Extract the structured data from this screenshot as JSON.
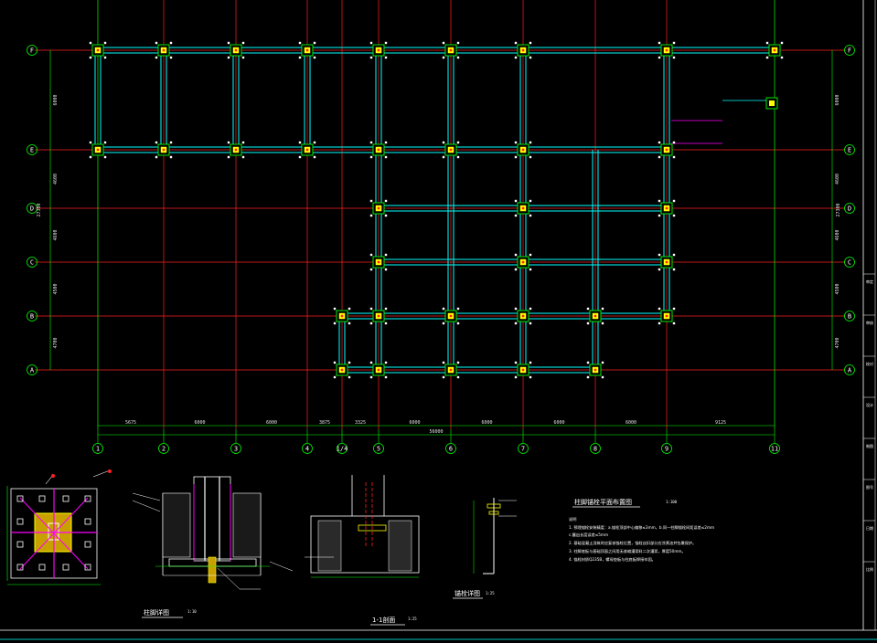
{
  "plan": {
    "col_axes": [
      "1",
      "2",
      "3",
      "4",
      "1/4",
      "5",
      "6",
      "7",
      "8",
      "9",
      "11"
    ],
    "row_axes": [
      "F",
      "E",
      "D",
      "C",
      "B",
      "A"
    ],
    "bottom_dims": [
      "5675",
      "6000",
      "6000",
      "3875",
      "3325",
      "6000",
      "6000",
      "6000",
      "6000",
      "9125"
    ],
    "total_dim": "56000",
    "left_dims": [
      "6000",
      "4600",
      "4600",
      "4500",
      "4700"
    ],
    "left_total": "27300",
    "right_dims": [
      "6000",
      "4600",
      "4600",
      "4500",
      "4700"
    ],
    "right_total": "27300"
  },
  "details": {
    "detail_a_title": "柱脚详图",
    "detail_a_scale": "1:10",
    "section_title": "1-1剖面",
    "section_scale": "1:25",
    "section_mark": "1-1",
    "anchor_title": "锚栓详图",
    "anchor_scale": "1:25"
  },
  "notes": {
    "heading": "柱脚锚栓平面布置图",
    "heading_scale": "1:100",
    "label": "说明",
    "lines": [
      "1. 预埋锚栓安装精度：a.锚栓顶部中心偏移≤3mm，b.同一柱脚锚栓间距误差≤2mm",
      "   c.露出长度误差≤5mm",
      "2. 基础混凝土浇筑时应复核锚栓位置，锚栓丝扣部分应涂黄油并包裹保护。",
      "3. 柱脚底板与基础顶面之间用无收缩灌浆料二次灌浆，厚度50mm。",
      "4. 锚栓材质Q235B，螺母垫板与柱底板焊接牢固。"
    ]
  },
  "title_block": {
    "cells": [
      "审定",
      "审核",
      "校对",
      "设计",
      "制图",
      "图号",
      "日期",
      "比例"
    ]
  },
  "colors": {
    "background": "#000000",
    "axis_line": "#ff2020",
    "beam": "#00ffff",
    "column": "#ffff00",
    "dimension": "#00ff00",
    "detail": "#ffffff",
    "accent": "#ff00ff"
  }
}
